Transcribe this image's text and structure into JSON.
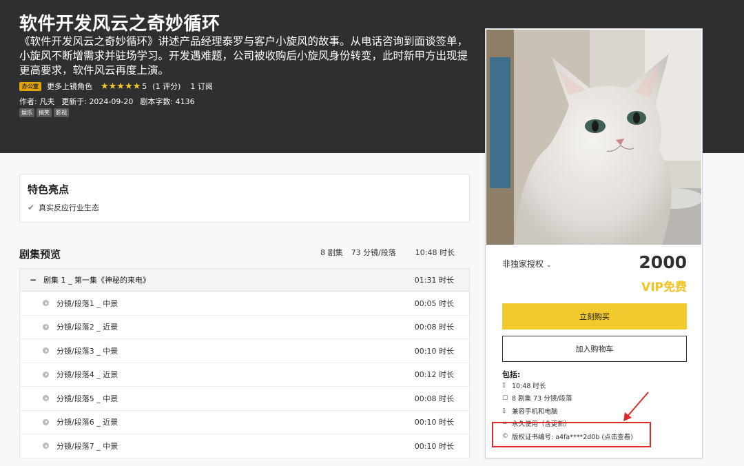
{
  "hero": {
    "title": "软件开发风云之奇妙循环",
    "description": "《软件开发风云之奇妙循环》讲述产品经理泰罗与客户小旋风的故事。从电话咨询到面谈签单，小旋风不断增需求并驻场学习。开发遇难题，公司被收购后小旋风身份转变，此时新甲方出现提更高要求，软件风云再度上演。",
    "category_badge": "办公室",
    "more_roles": "更多上镜角色",
    "stars_icon": "★★★★★",
    "rating": "5",
    "rating_count": "(1 评分)",
    "subscriptions": "1 订阅",
    "author_label": "作者:",
    "author": "凡夫",
    "updated_label": "更新于:",
    "updated": "2024-09-20",
    "wordcount_label": "剧本字数:",
    "wordcount": "4136",
    "tags": [
      "娱乐",
      "搞笑",
      "影视"
    ]
  },
  "highlights": {
    "title": "特色亮点",
    "items": [
      "真实反应行业生态"
    ]
  },
  "episodes": {
    "title": "剧集预览",
    "count": "8 剧集",
    "segments": "73 分镜/段落",
    "duration": "10:48 时长",
    "section": {
      "label": "剧集 1 _ 第一集《神秘的来电》",
      "time": "01:31 时长"
    },
    "rows": [
      {
        "label": "分镜/段落1 _ 中景",
        "time": "00:05 时长"
      },
      {
        "label": "分镜/段落2 _ 近景",
        "time": "00:08 时长"
      },
      {
        "label": "分镜/段落3 _ 中景",
        "time": "00:10 时长"
      },
      {
        "label": "分镜/段落4 _ 近景",
        "time": "00:12 时长"
      },
      {
        "label": "分镜/段落5 _ 中景",
        "time": "00:08 时长"
      },
      {
        "label": "分镜/段落6 _ 近景",
        "time": "00:10 时长"
      },
      {
        "label": "分镜/段落7 _ 中景",
        "time": "00:10 时长"
      }
    ]
  },
  "card": {
    "license": "非独家授权",
    "price": "2000",
    "vip": "VIP免费",
    "buy": "立刻购买",
    "cart": "加入购物车",
    "includes_title": "包括:",
    "includes": [
      {
        "icon": "file-icon",
        "text": "10:48 时长"
      },
      {
        "icon": "document-icon",
        "text": "8 剧集 73 分镜/段落"
      },
      {
        "icon": "mobile-icon",
        "text": "兼容手机和电脑"
      },
      {
        "icon": "infinity-icon",
        "text": "永久使用（含更新）"
      },
      {
        "icon": "copyright-icon",
        "text": "版权证书编号: a4fa****2d0b (点击查看)"
      }
    ]
  },
  "colors": {
    "header_bg": "#2d2f31",
    "accent_yellow": "#f3ca2e",
    "annotation_red": "#e12828"
  }
}
